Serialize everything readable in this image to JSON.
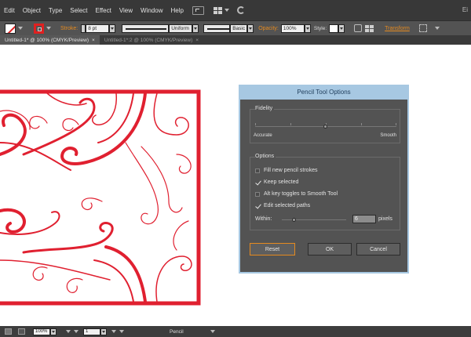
{
  "menubar": {
    "items": [
      "Edit",
      "Object",
      "Type",
      "Select",
      "Effect",
      "View",
      "Window",
      "Help"
    ],
    "window_edge": "Ei"
  },
  "controlbar": {
    "stroke_label": "Stroke:",
    "stroke_weight": "8 pt",
    "profile": "Uniform",
    "brush": "Basic",
    "opacity_label": "Opacity:",
    "opacity_value": "100%",
    "style_label": "Style:",
    "transform_label": "Transform",
    "accent_color": "#e58a1f"
  },
  "tabs": [
    {
      "label": "Untitled-1* @ 100% (CMYK/Preview)",
      "close": "×",
      "active": true
    },
    {
      "label": "Untitled-1*:2 @ 100% (CMYK/Preview)",
      "close": "×",
      "active": false
    }
  ],
  "artwork": {
    "stroke_color": "#e02030"
  },
  "dialog": {
    "title": "Pencil Tool Options",
    "fidelity": {
      "title": "Fidelity",
      "left_label": "Accurate",
      "right_label": "Smooth",
      "level": 0.5
    },
    "options": {
      "title": "Options",
      "items": [
        {
          "label": "Fill new pencil strokes",
          "checked": false
        },
        {
          "label": "Keep selected",
          "checked": true
        },
        {
          "label": "Alt key toggles to Smooth Tool",
          "checked": false
        },
        {
          "label": "Edit selected paths",
          "checked": true
        }
      ],
      "within_label": "Within:",
      "within_value": "6",
      "within_unit": "pixels"
    },
    "buttons": {
      "reset": "Reset",
      "ok": "OK",
      "cancel": "Cancel"
    }
  },
  "statusbar": {
    "zoom": "100%",
    "artboard": "1",
    "tool": "Pencil"
  }
}
